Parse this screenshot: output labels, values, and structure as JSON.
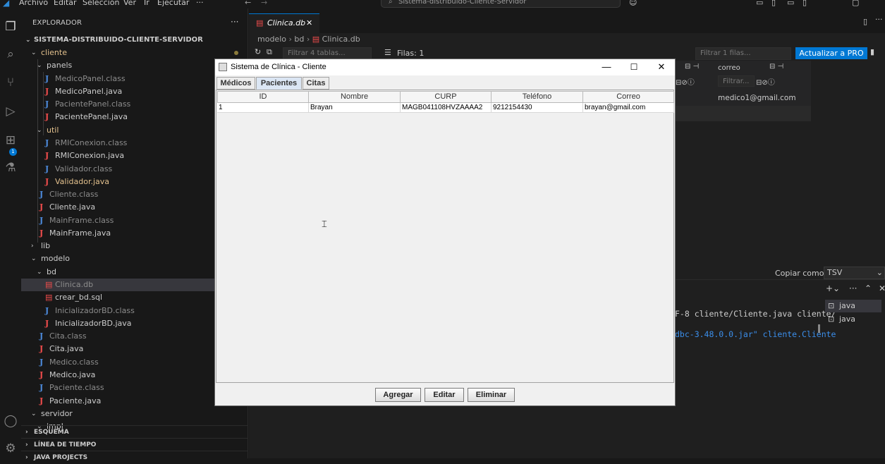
{
  "titlebar": {
    "menu": [
      "Archivo",
      "Editar",
      "Selección",
      "Ver",
      "Ir",
      "Ejecutar",
      "···"
    ],
    "search": "Sistema-distribuido-Cliente-Servidor"
  },
  "activity": {
    "extensions_badge": "1"
  },
  "sidebar": {
    "title": "EXPLORADOR",
    "root": "SISTEMA-DISTRIBUIDO-CLIENTE-SERVIDOR",
    "tree": [
      {
        "label": "cliente",
        "kind": "folder",
        "depth": 1,
        "color": "yellow",
        "open": true
      },
      {
        "label": "panels",
        "kind": "folder",
        "depth": 2,
        "open": true
      },
      {
        "label": "MedicoPanel.class",
        "kind": "class",
        "depth": 3
      },
      {
        "label": "MedicoPanel.java",
        "kind": "java",
        "depth": 3
      },
      {
        "label": "PacientePanel.class",
        "kind": "class",
        "depth": 3
      },
      {
        "label": "PacientePanel.java",
        "kind": "java",
        "depth": 3
      },
      {
        "label": "util",
        "kind": "folder",
        "depth": 2,
        "color": "yellow",
        "open": true
      },
      {
        "label": "RMIConexion.class",
        "kind": "class",
        "depth": 3
      },
      {
        "label": "RMIConexion.java",
        "kind": "java",
        "depth": 3
      },
      {
        "label": "Validador.class",
        "kind": "class",
        "depth": 3
      },
      {
        "label": "Validador.java",
        "kind": "java",
        "depth": 3,
        "color": "yellow"
      },
      {
        "label": "Cliente.class",
        "kind": "class",
        "depth": 2
      },
      {
        "label": "Cliente.java",
        "kind": "java",
        "depth": 2
      },
      {
        "label": "MainFrame.class",
        "kind": "class",
        "depth": 2
      },
      {
        "label": "MainFrame.java",
        "kind": "java",
        "depth": 2
      },
      {
        "label": "lib",
        "kind": "folder",
        "depth": 1,
        "open": false
      },
      {
        "label": "modelo",
        "kind": "folder",
        "depth": 1,
        "open": true
      },
      {
        "label": "bd",
        "kind": "folder",
        "depth": 2,
        "open": true
      },
      {
        "label": "Clinica.db",
        "kind": "db",
        "depth": 3,
        "selected": true
      },
      {
        "label": "crear_bd.sql",
        "kind": "db",
        "depth": 3
      },
      {
        "label": "InicializadorBD.class",
        "kind": "class",
        "depth": 3
      },
      {
        "label": "InicializadorBD.java",
        "kind": "java",
        "depth": 3
      },
      {
        "label": "Cita.class",
        "kind": "class",
        "depth": 2
      },
      {
        "label": "Cita.java",
        "kind": "java",
        "depth": 2
      },
      {
        "label": "Medico.class",
        "kind": "class",
        "depth": 2
      },
      {
        "label": "Medico.java",
        "kind": "java",
        "depth": 2
      },
      {
        "label": "Paciente.class",
        "kind": "class",
        "depth": 2
      },
      {
        "label": "Paciente.java",
        "kind": "java",
        "depth": 2
      },
      {
        "label": "servidor",
        "kind": "folder",
        "depth": 1,
        "open": true
      },
      {
        "label": "impl",
        "kind": "folder",
        "depth": 2,
        "open": true
      }
    ],
    "sections": [
      "ESQUEMA",
      "LÍNEA DE TIEMPO",
      "JAVA PROJECTS"
    ]
  },
  "editor": {
    "tab": "Clinica.db",
    "breadcrumb": [
      "modelo",
      "bd",
      "Clinica.db"
    ],
    "filter_tables": "Filtrar 4 tablas...",
    "rows_label": "Filas: 1",
    "filter_rows": "Filtrar 1 filas...",
    "pro_button": "Actualizar a PRO",
    "column_header": "correo",
    "column_filter": "Filtrar...",
    "cell_value": "medico1@gmail.com",
    "copy_as": "Copiar como",
    "copy_format": "TSV",
    "terminal_lines": [
      "F-8 cliente/Cliente.java cliente/",
      "dbc-3.48.0.0.jar\" cliente.Cliente"
    ],
    "terminals": [
      "java",
      "java"
    ]
  },
  "swing": {
    "title": "Sistema de Clínica - Cliente",
    "tabs": [
      "Médicos",
      "Pacientes",
      "Citas"
    ],
    "selected_tab": "Pacientes",
    "columns": [
      "ID",
      "Nombre",
      "CURP",
      "Teléfono",
      "Correo"
    ],
    "rows": [
      [
        "1",
        "Brayan",
        "MAGB041108HVZAAAA2",
        "9212154430",
        "brayan@gmail.com"
      ]
    ],
    "buttons": [
      "Agregar",
      "Editar",
      "Eliminar"
    ]
  }
}
